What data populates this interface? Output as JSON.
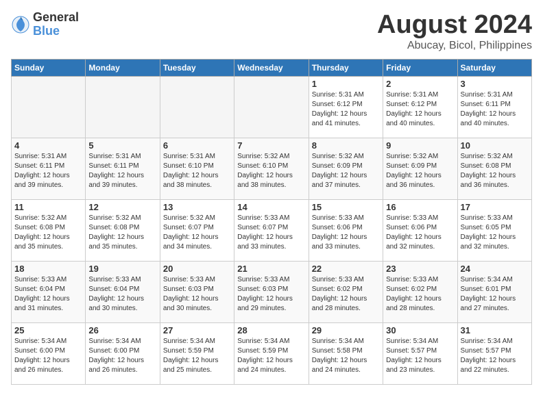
{
  "logo": {
    "general": "General",
    "blue": "Blue"
  },
  "header": {
    "month": "August 2024",
    "location": "Abucay, Bicol, Philippines"
  },
  "weekdays": [
    "Sunday",
    "Monday",
    "Tuesday",
    "Wednesday",
    "Thursday",
    "Friday",
    "Saturday"
  ],
  "weeks": [
    [
      {
        "day": "",
        "empty": true
      },
      {
        "day": "",
        "empty": true
      },
      {
        "day": "",
        "empty": true
      },
      {
        "day": "",
        "empty": true
      },
      {
        "day": "1",
        "sunrise": "5:31 AM",
        "sunset": "6:12 PM",
        "daylight": "12 hours and 41 minutes."
      },
      {
        "day": "2",
        "sunrise": "5:31 AM",
        "sunset": "6:12 PM",
        "daylight": "12 hours and 40 minutes."
      },
      {
        "day": "3",
        "sunrise": "5:31 AM",
        "sunset": "6:11 PM",
        "daylight": "12 hours and 40 minutes."
      }
    ],
    [
      {
        "day": "4",
        "sunrise": "5:31 AM",
        "sunset": "6:11 PM",
        "daylight": "12 hours and 39 minutes."
      },
      {
        "day": "5",
        "sunrise": "5:31 AM",
        "sunset": "6:11 PM",
        "daylight": "12 hours and 39 minutes."
      },
      {
        "day": "6",
        "sunrise": "5:31 AM",
        "sunset": "6:10 PM",
        "daylight": "12 hours and 38 minutes."
      },
      {
        "day": "7",
        "sunrise": "5:32 AM",
        "sunset": "6:10 PM",
        "daylight": "12 hours and 38 minutes."
      },
      {
        "day": "8",
        "sunrise": "5:32 AM",
        "sunset": "6:09 PM",
        "daylight": "12 hours and 37 minutes."
      },
      {
        "day": "9",
        "sunrise": "5:32 AM",
        "sunset": "6:09 PM",
        "daylight": "12 hours and 36 minutes."
      },
      {
        "day": "10",
        "sunrise": "5:32 AM",
        "sunset": "6:08 PM",
        "daylight": "12 hours and 36 minutes."
      }
    ],
    [
      {
        "day": "11",
        "sunrise": "5:32 AM",
        "sunset": "6:08 PM",
        "daylight": "12 hours and 35 minutes."
      },
      {
        "day": "12",
        "sunrise": "5:32 AM",
        "sunset": "6:08 PM",
        "daylight": "12 hours and 35 minutes."
      },
      {
        "day": "13",
        "sunrise": "5:32 AM",
        "sunset": "6:07 PM",
        "daylight": "12 hours and 34 minutes."
      },
      {
        "day": "14",
        "sunrise": "5:33 AM",
        "sunset": "6:07 PM",
        "daylight": "12 hours and 33 minutes."
      },
      {
        "day": "15",
        "sunrise": "5:33 AM",
        "sunset": "6:06 PM",
        "daylight": "12 hours and 33 minutes."
      },
      {
        "day": "16",
        "sunrise": "5:33 AM",
        "sunset": "6:06 PM",
        "daylight": "12 hours and 32 minutes."
      },
      {
        "day": "17",
        "sunrise": "5:33 AM",
        "sunset": "6:05 PM",
        "daylight": "12 hours and 32 minutes."
      }
    ],
    [
      {
        "day": "18",
        "sunrise": "5:33 AM",
        "sunset": "6:04 PM",
        "daylight": "12 hours and 31 minutes."
      },
      {
        "day": "19",
        "sunrise": "5:33 AM",
        "sunset": "6:04 PM",
        "daylight": "12 hours and 30 minutes."
      },
      {
        "day": "20",
        "sunrise": "5:33 AM",
        "sunset": "6:03 PM",
        "daylight": "12 hours and 30 minutes."
      },
      {
        "day": "21",
        "sunrise": "5:33 AM",
        "sunset": "6:03 PM",
        "daylight": "12 hours and 29 minutes."
      },
      {
        "day": "22",
        "sunrise": "5:33 AM",
        "sunset": "6:02 PM",
        "daylight": "12 hours and 28 minutes."
      },
      {
        "day": "23",
        "sunrise": "5:33 AM",
        "sunset": "6:02 PM",
        "daylight": "12 hours and 28 minutes."
      },
      {
        "day": "24",
        "sunrise": "5:34 AM",
        "sunset": "6:01 PM",
        "daylight": "12 hours and 27 minutes."
      }
    ],
    [
      {
        "day": "25",
        "sunrise": "5:34 AM",
        "sunset": "6:00 PM",
        "daylight": "12 hours and 26 minutes."
      },
      {
        "day": "26",
        "sunrise": "5:34 AM",
        "sunset": "6:00 PM",
        "daylight": "12 hours and 26 minutes."
      },
      {
        "day": "27",
        "sunrise": "5:34 AM",
        "sunset": "5:59 PM",
        "daylight": "12 hours and 25 minutes."
      },
      {
        "day": "28",
        "sunrise": "5:34 AM",
        "sunset": "5:59 PM",
        "daylight": "12 hours and 24 minutes."
      },
      {
        "day": "29",
        "sunrise": "5:34 AM",
        "sunset": "5:58 PM",
        "daylight": "12 hours and 24 minutes."
      },
      {
        "day": "30",
        "sunrise": "5:34 AM",
        "sunset": "5:57 PM",
        "daylight": "12 hours and 23 minutes."
      },
      {
        "day": "31",
        "sunrise": "5:34 AM",
        "sunset": "5:57 PM",
        "daylight": "12 hours and 22 minutes."
      }
    ]
  ]
}
